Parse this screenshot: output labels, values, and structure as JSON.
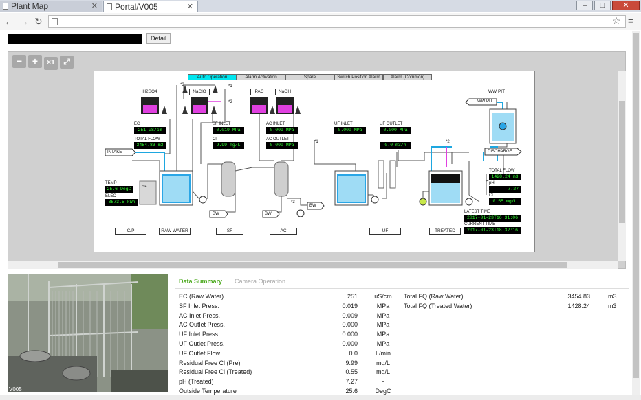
{
  "browser": {
    "tabs": [
      {
        "label": "Plant Map"
      },
      {
        "label": "Portal/V005"
      }
    ],
    "window_controls": [
      "–",
      "□",
      "✕"
    ]
  },
  "toolbar": {
    "detail_label": "Detail"
  },
  "zoom": {
    "minus": "−",
    "plus": "+",
    "reset": "×1",
    "fit": "⤢"
  },
  "panel_tabs": [
    "Auto Operation",
    "Alarm Activation",
    "Spare",
    "Switch Position Alarm",
    "Alarm (Common)"
  ],
  "diagram": {
    "chemicals": [
      "H2SO4",
      "NaClO",
      "PAC",
      "NaOH"
    ],
    "ww_pit": "WW PIT",
    "ww_pit_tag": "WW PIT",
    "intake": "INTAKE",
    "discharge": "DISCHARGE",
    "bw1": "BW",
    "bw2": "BW",
    "bw3": "BW",
    "cp_panel": "SE",
    "markers": {
      "m3a": "*3",
      "m1a": "*1",
      "m2a": "*2",
      "m1b": "*1",
      "m2b": "*2",
      "m3b": "*3"
    },
    "readings": {
      "ec": {
        "label": "EC",
        "value": "251 uS/cm"
      },
      "total_flow_in": {
        "label": "TOTAL FLOW",
        "value": "3454.83 m3"
      },
      "temp": {
        "label": "TEMP",
        "value": "25.6 DegC"
      },
      "elec": {
        "label": "ELEC",
        "value": "3573.5 kWh"
      },
      "sf_inlet": {
        "label": "SF INLET",
        "value": "0.019 MPa"
      },
      "cl_sf": {
        "label": "Cl",
        "value": "9.99 mg/L"
      },
      "ac_inlet": {
        "label": "AC INLET",
        "value": "0.009 MPa"
      },
      "ac_outlet": {
        "label": "AC OUTLET",
        "value": "0.000 MPa"
      },
      "uf_inlet": {
        "label": "UF INLET",
        "value": "0.000 MPa"
      },
      "uf_outlet": {
        "label": "UF OUTLET",
        "value": "0.000 MPa"
      },
      "uf_flow": {
        "value": "0.0 m3/h"
      },
      "total_flow_out": {
        "label": "TOTAL FLOW",
        "value": "1428.24 m3"
      },
      "ph": {
        "label": "pH",
        "value": "7.27"
      },
      "cl_out": {
        "label": "Cl",
        "value": "0.55 mg/L"
      },
      "latest_time": {
        "label": "LATEST TIME",
        "value": "2017-01-23T16:31:06"
      },
      "current_time": {
        "label": "CURRENT TIME",
        "value": "2017-01-23T18:32:16"
      }
    },
    "sections": [
      "C/P",
      "RAW WATER",
      "SF",
      "AC",
      "UF",
      "TREATED"
    ]
  },
  "camera": {
    "caption": "V005"
  },
  "summary": {
    "tabs": [
      "Data Summary",
      "Camera Operation"
    ],
    "rows": [
      {
        "name": "EC  (Raw Water)",
        "value": "251",
        "unit": "uS/cm"
      },
      {
        "name": "SF Inlet Press.",
        "value": "0.019",
        "unit": "MPa"
      },
      {
        "name": "AC Inlet Press.",
        "value": "0.009",
        "unit": "MPa"
      },
      {
        "name": "AC Outlet Press.",
        "value": "0.000",
        "unit": "MPa"
      },
      {
        "name": "UF Inlet Press.",
        "value": "0.000",
        "unit": "MPa"
      },
      {
        "name": "UF Outlet Press.",
        "value": "0.000",
        "unit": "MPa"
      },
      {
        "name": "UF Outlet Flow",
        "value": "0.0",
        "unit": "L/min"
      },
      {
        "name": "Residual Free Cl (Pre)",
        "value": "9.99",
        "unit": "mg/L"
      },
      {
        "name": "Residual Free Cl (Treated)",
        "value": "0.55",
        "unit": "mg/L"
      },
      {
        "name": "pH (Treated)",
        "value": "7.27",
        "unit": "-"
      },
      {
        "name": "Outside Temperature",
        "value": "25.6",
        "unit": "DegC"
      }
    ],
    "totals": [
      {
        "name": "Total FQ  (Raw Water)",
        "value": "3454.83",
        "unit": "m3"
      },
      {
        "name": "Total FQ  (Treated Water)",
        "value": "1428.24",
        "unit": "m3"
      }
    ]
  },
  "colors": {
    "accent_green": "#4caa1e",
    "reading_text": "#33ff33",
    "tab_active": "#00e5ee",
    "water": "#2aa6e6",
    "chem_line": "#e040e0"
  }
}
